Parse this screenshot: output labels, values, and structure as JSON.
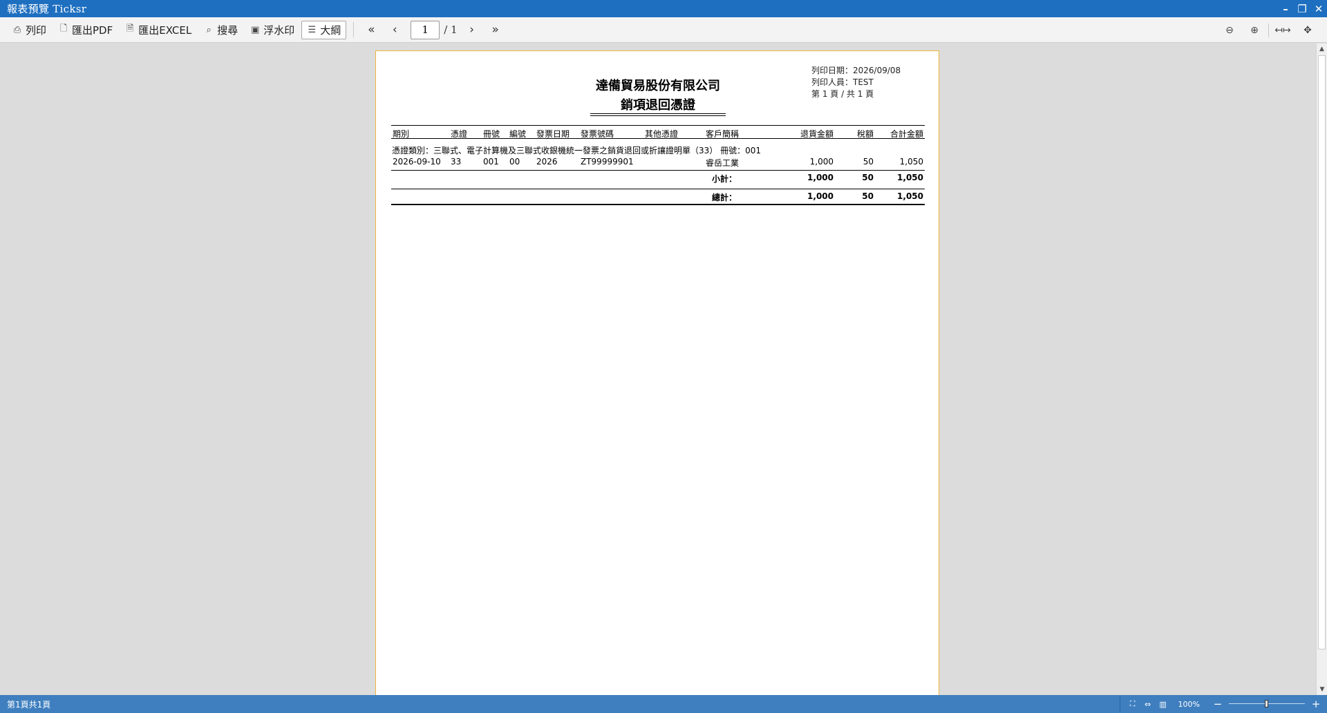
{
  "window": {
    "title": "報表預覽 Ticksr"
  },
  "toolbar": {
    "print": "列印",
    "export_pdf": "匯出PDF",
    "export_excel": "匯出EXCEL",
    "search": "搜尋",
    "watermark": "浮水印",
    "outline": "大綱",
    "current_page": "1",
    "total_pages": "/ 1"
  },
  "report": {
    "company": "達備貿易股份有限公司",
    "title": "銷項退回憑證",
    "print_date": "列印日期：2026/09/08",
    "print_user": "列印人員：TEST",
    "page_info": "第 1 頁 / 共 1 頁",
    "columns": {
      "period": "期別",
      "voucher": "憑證",
      "book": "冊號",
      "seq": "編號",
      "invoice_date": "發票日期",
      "invoice_no": "發票號碼",
      "other_voucher": "其他憑證",
      "customer": "客戶簡稱",
      "return_amount": "退貨金額",
      "tax": "稅額",
      "total_amount": "合計金額"
    },
    "group_header": "憑證類別：三聯式、電子計算機及三聯式收銀機統一發票之銷貨退回或折讓證明單（33）   冊號：001",
    "rows": [
      {
        "period": "2026-09-10",
        "voucher": "33",
        "book": "001",
        "seq": "00",
        "invoice_date": "2026",
        "invoice_no": "ZT99999901",
        "other_voucher": "",
        "customer": "睿岳工業",
        "return_amount": "1,000",
        "tax": "50",
        "total_amount": "1,050"
      }
    ],
    "subtotal": {
      "label": "小計：",
      "return_amount": "1,000",
      "tax": "50",
      "total_amount": "1,050"
    },
    "grand_total": {
      "label": "總計：",
      "return_amount": "1,000",
      "tax": "50",
      "total_amount": "1,050"
    }
  },
  "status": {
    "page_text": "第1頁共1頁",
    "zoom": "100%",
    "zoom_level_percent": 100
  },
  "colors": {
    "titlebar": "#1e6fc0",
    "statusbar": "#3f7fbf",
    "page_border": "#f0b43c"
  }
}
